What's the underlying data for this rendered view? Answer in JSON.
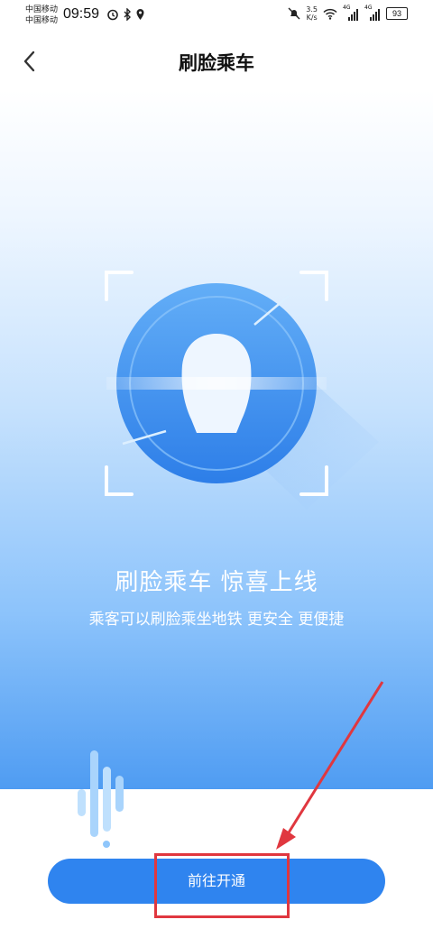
{
  "status_bar": {
    "carrier_1": "中国移动",
    "carrier_2": "中国移动",
    "time": "09:59",
    "net_speed_value": "3.5",
    "net_speed_unit": "K/s",
    "network_1": "4G",
    "network_2": "4G",
    "battery": "93"
  },
  "header": {
    "title": "刷脸乘车"
  },
  "hero": {
    "title": "刷脸乘车 惊喜上线",
    "subtitle": "乘客可以刷脸乘坐地铁 更安全 更便捷"
  },
  "actions": {
    "primary_label": "前往开通"
  },
  "colors": {
    "accent": "#2f84ef",
    "annotation": "#e0373f"
  }
}
